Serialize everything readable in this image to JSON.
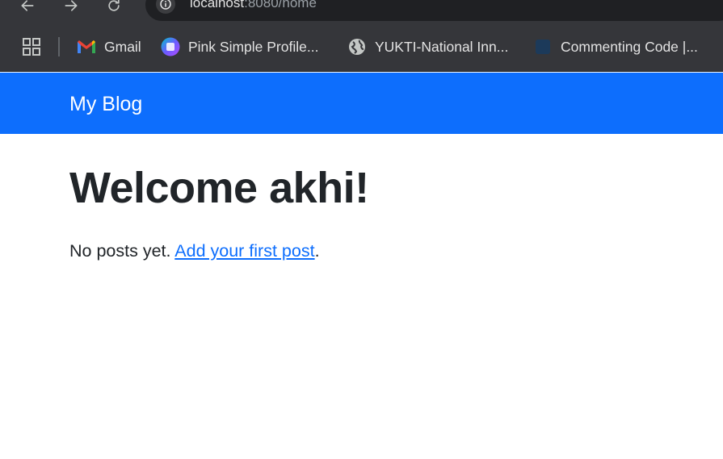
{
  "browser": {
    "url_host": "localhost",
    "url_path": ":8080/home",
    "bookmarks": [
      {
        "label": "Gmail",
        "icon": "gmail-icon"
      },
      {
        "label": "Pink Simple Profile...",
        "icon": "canva-icon"
      },
      {
        "label": "YUKTI-National Inn...",
        "icon": "globe-icon"
      },
      {
        "label": "Commenting Code |...",
        "icon": "site-icon"
      }
    ]
  },
  "navbar": {
    "brand": "My Blog",
    "color": "#0d6efd"
  },
  "main": {
    "welcome": "Welcome akhi!",
    "empty_text": "No posts yet.",
    "add_link": "Add your first post",
    "after_link": "."
  }
}
